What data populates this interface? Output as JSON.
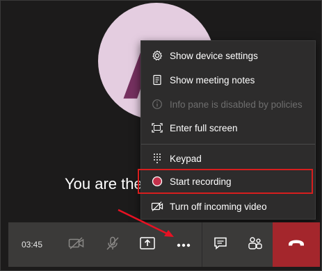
{
  "avatar": {
    "initial": "A"
  },
  "status_text": "You are the only one here",
  "menu": {
    "items": [
      {
        "label": "Show device settings",
        "icon": "gear-icon",
        "disabled": false
      },
      {
        "label": "Show meeting notes",
        "icon": "notes-icon",
        "disabled": false
      },
      {
        "label": "Info pane is disabled by policies",
        "icon": "info-icon",
        "disabled": true
      },
      {
        "label": "Enter full screen",
        "icon": "fullscreen-icon",
        "disabled": false
      },
      {
        "label": "Keypad",
        "icon": "keypad-icon",
        "disabled": false
      },
      {
        "label": "Start recording",
        "icon": "record-icon",
        "disabled": false
      },
      {
        "label": "Turn off incoming video",
        "icon": "video-off-icon",
        "disabled": false
      }
    ]
  },
  "toolbar": {
    "timer": "03:45",
    "buttons": [
      {
        "name": "camera-off-button",
        "icon": "camera-off-icon"
      },
      {
        "name": "mic-off-button",
        "icon": "mic-off-icon"
      },
      {
        "name": "share-button",
        "icon": "share-icon"
      },
      {
        "name": "more-options-button",
        "icon": "ellipsis-icon"
      },
      {
        "name": "chat-button",
        "icon": "chat-icon"
      },
      {
        "name": "participants-button",
        "icon": "participants-icon"
      },
      {
        "name": "hang-up-button",
        "icon": "hang-up-icon"
      }
    ]
  },
  "colors": {
    "background": "#1c1b1b",
    "menu": "#2d2c2c",
    "toolbar": "#3b3a39",
    "hangup": "#a4262c",
    "highlight": "#d81e1e",
    "avatar_bg": "#e4cde0",
    "avatar_fg": "#75305f",
    "record_dot": "#c4314b"
  }
}
